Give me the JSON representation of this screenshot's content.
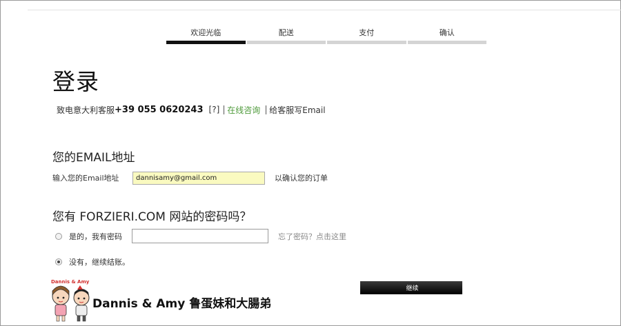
{
  "steps": [
    {
      "label": "欢迎光临",
      "active": true
    },
    {
      "label": "配送",
      "active": false
    },
    {
      "label": "支付",
      "active": false
    },
    {
      "label": "确认",
      "active": false
    }
  ],
  "page_title": "登录",
  "contact": {
    "prefix": "致电意大利客服",
    "phone": "+39 055 0620243",
    "help": "[?]",
    "chat": "在线咨询",
    "email_link": "给客服写Email"
  },
  "email_section": {
    "heading": "您的EMAIL地址",
    "label": "输入您的Email地址",
    "value": "dannisamy@gmail.com",
    "note": "以确认您的订单"
  },
  "password_section": {
    "heading": "您有 FORZIERI.COM 网站的密码吗？",
    "yes_label": "是的，我有密码",
    "forgot": "忘了密码？点击这里",
    "no_label": "没有，继续结账。"
  },
  "continue_label": "继续",
  "watermark": {
    "text": "Dannis & Amy 鲁蛋妹和大腸弟",
    "logo_text": "Dannis & Amy"
  },
  "colors": {
    "active_step": "#111111",
    "inactive_step": "#d4d4d4",
    "chat_link": "#4e9a3a",
    "email_highlight": "#fafac0"
  }
}
